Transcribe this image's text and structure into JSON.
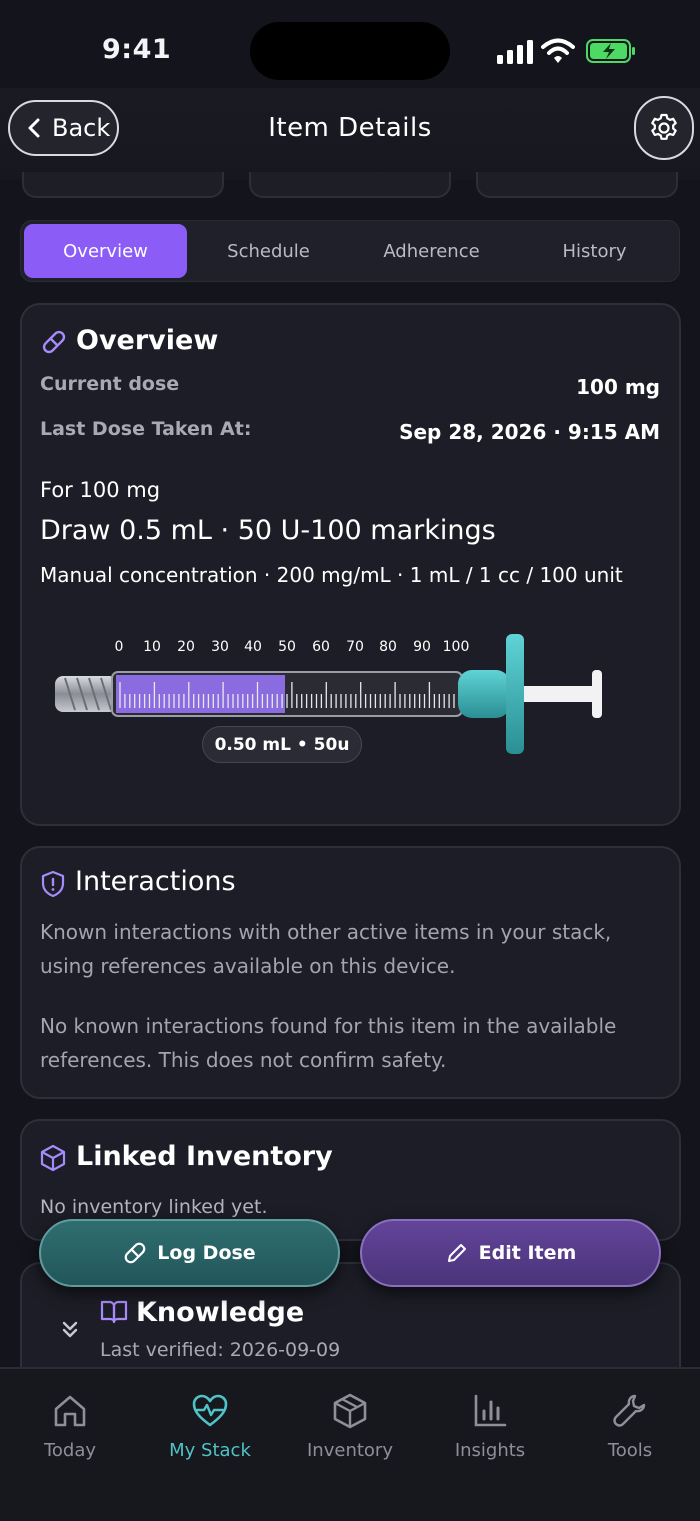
{
  "status_bar": {
    "time": "9:41"
  },
  "header": {
    "back_label": "Back",
    "title": "Item Details"
  },
  "tabs": [
    {
      "label": "Overview",
      "active": true
    },
    {
      "label": "Schedule",
      "active": false
    },
    {
      "label": "Adherence",
      "active": false
    },
    {
      "label": "History",
      "active": false
    }
  ],
  "overview": {
    "title": "Overview",
    "current_dose_label": "Current dose",
    "current_dose_value": "100 mg",
    "last_dose_label": "Last Dose Taken At:",
    "last_dose_value": "Sep 28, 2026 · 9:15 AM",
    "for_dose": "For 100 mg",
    "draw_text": "Draw 0.5 mL · 50 U-100 markings",
    "concentration": "Manual concentration · 200 mg/mL · 1 mL / 1 cc / 100 unit",
    "syringe_scale": [
      "0",
      "10",
      "20",
      "30",
      "40",
      "50",
      "60",
      "70",
      "80",
      "90",
      "100"
    ],
    "syringe_fill_fraction": 0.5,
    "syringe_readout": "0.50 mL • 50u"
  },
  "interactions": {
    "title": "Interactions",
    "description": "Known interactions with other active items in your stack, using references available on this device.",
    "result": "No known interactions found for this item in the available references. This does not confirm safety."
  },
  "linked_inventory": {
    "title": "Linked Inventory",
    "empty_text": "No inventory linked yet."
  },
  "actions": {
    "log_dose": "Log Dose",
    "edit_item": "Edit Item"
  },
  "knowledge": {
    "title": "Knowledge",
    "last_verified": "Last verified: 2026-09-09"
  },
  "tab_bar": [
    {
      "label": "Today",
      "icon": "home-icon",
      "active": false
    },
    {
      "label": "My Stack",
      "icon": "heart-pulse-icon",
      "active": true
    },
    {
      "label": "Inventory",
      "icon": "box-icon",
      "active": false
    },
    {
      "label": "Insights",
      "icon": "bar-chart-icon",
      "active": false
    },
    {
      "label": "Tools",
      "icon": "wrench-icon",
      "active": false
    }
  ],
  "colors": {
    "accent_purple": "#8b5cf6",
    "accent_teal": "#4fc3c7",
    "background": "#14151c"
  }
}
